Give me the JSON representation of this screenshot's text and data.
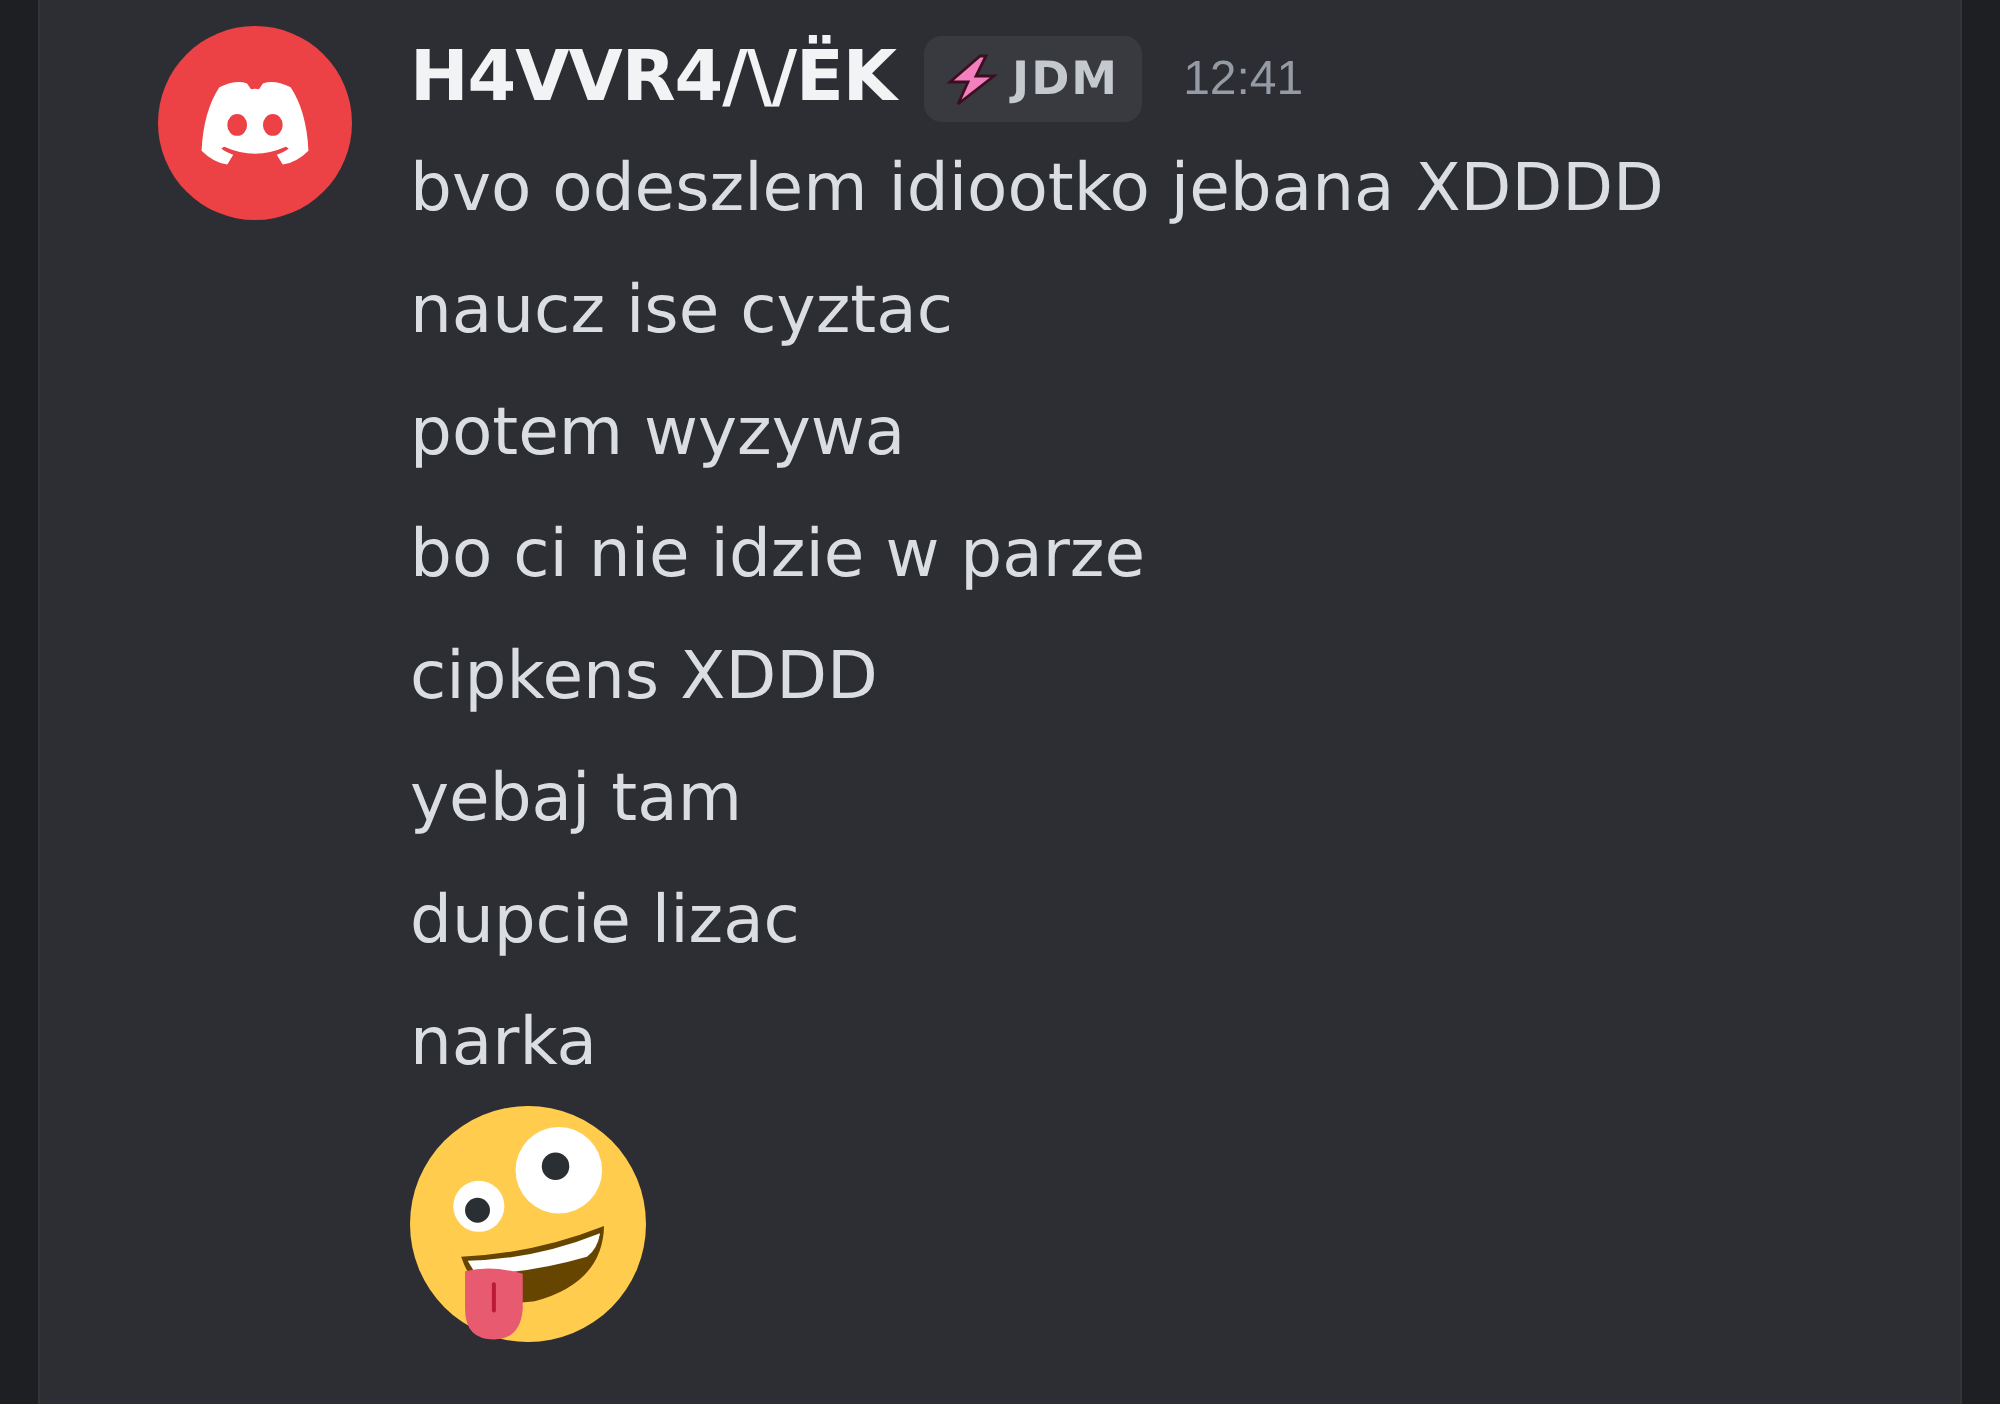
{
  "message": {
    "author": "H4VVR4/\\/ËK",
    "tag": {
      "label": "JDM"
    },
    "timestamp": "12:41",
    "lines": [
      {
        "kind": "text",
        "text": "bvo odeszlem idiootko jebana XDDDD"
      },
      {
        "kind": "text",
        "text": "naucz ise cyztac"
      },
      {
        "kind": "text",
        "text": "potem wyzywa"
      },
      {
        "kind": "text",
        "text": "bo ci nie idzie w parze"
      },
      {
        "kind": "text",
        "text": "cipkens XDDD"
      },
      {
        "kind": "text",
        "text": "yebaj tam"
      },
      {
        "kind": "text",
        "text": "dupcie lizac"
      },
      {
        "kind": "text",
        "text": "narka"
      },
      {
        "kind": "emoji"
      }
    ]
  }
}
